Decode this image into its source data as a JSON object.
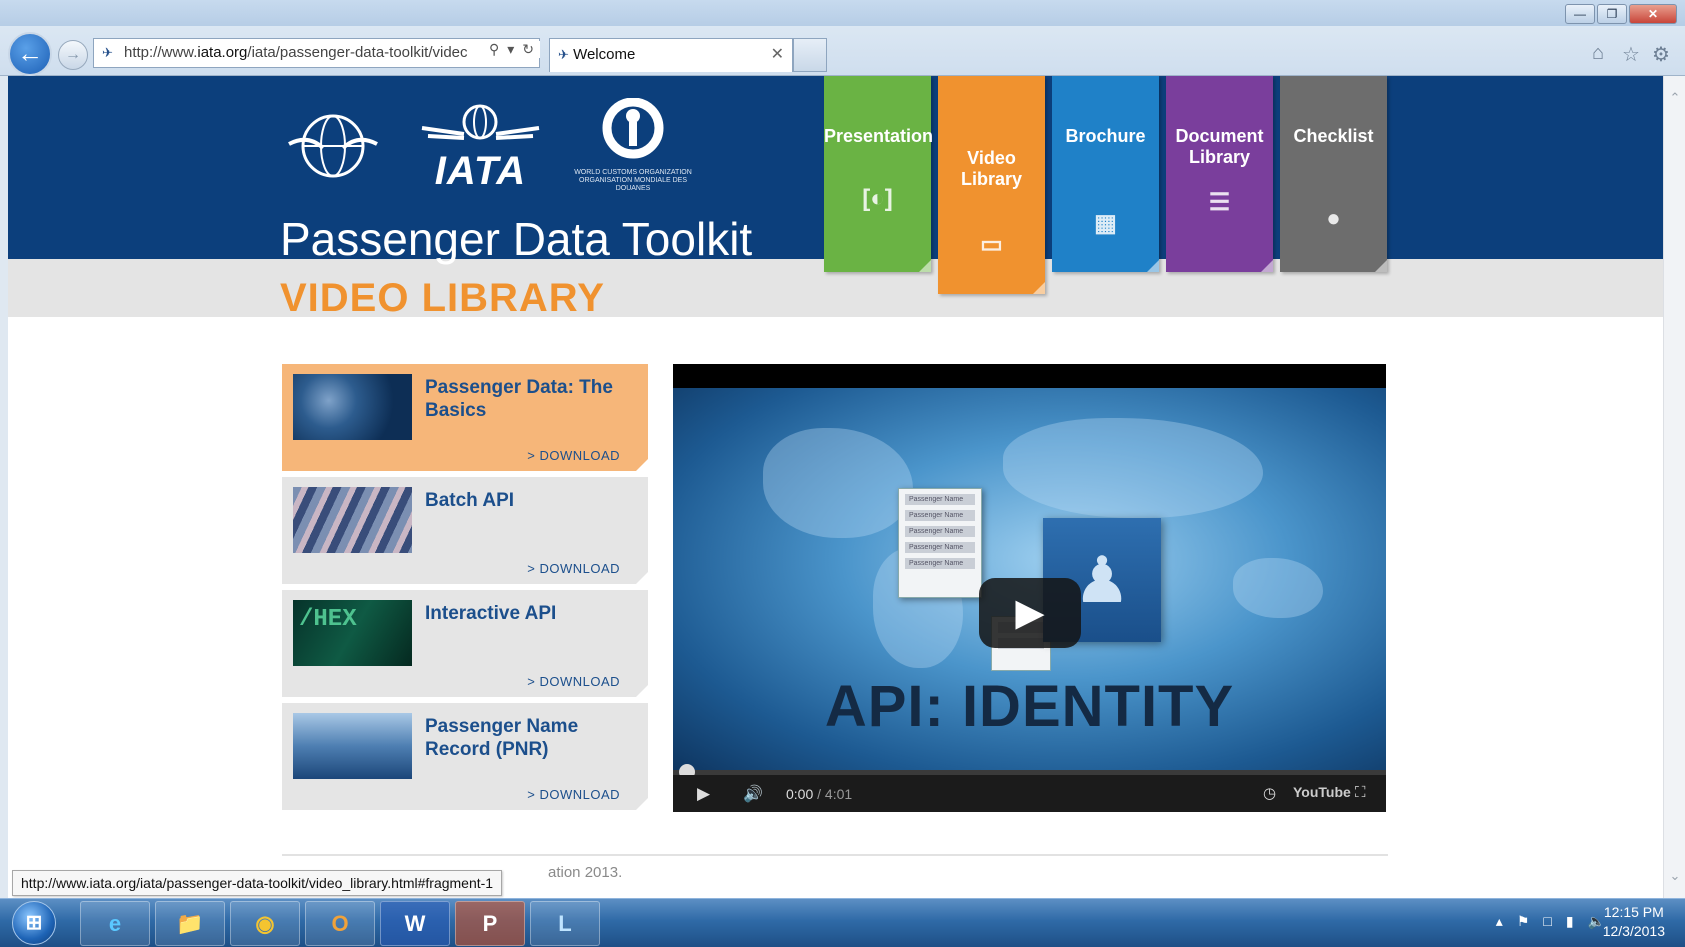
{
  "browser": {
    "address_prefix": "http://www.",
    "address_host": "iata.org",
    "address_rest": "/iata/passenger-data-toolkit/videc",
    "tab_title": "Welcome",
    "status_url": "http://www.iata.org/iata/passenger-data-toolkit/video_library.html#fragment-1"
  },
  "header": {
    "site_title": "Passenger Data Toolkit",
    "page_heading": "VIDEO LIBRARY",
    "logo_iata": "IATA",
    "logo_wco_line1": "WORLD CUSTOMS ORGANIZATION",
    "logo_wco_line2": "ORGANISATION MONDIALE DES DOUANES"
  },
  "nav": {
    "presentation": "Presentation",
    "video_line1": "Video",
    "video_line2": "Library",
    "brochure": "Brochure",
    "document_line1": "Document",
    "document_line2": "Library",
    "checklist": "Checklist"
  },
  "videos": [
    {
      "title": "Passenger Data: The Basics",
      "download": "> DOWNLOAD"
    },
    {
      "title": "Batch API",
      "download": "> DOWNLOAD"
    },
    {
      "title": "Interactive API",
      "download": "> DOWNLOAD",
      "thumb_text": "/HEX"
    },
    {
      "title": "Passenger Name Record (PNR)",
      "download": "> DOWNLOAD"
    }
  ],
  "player": {
    "video_title": "API: IDENTITY",
    "time": "0:00",
    "duration": "/ 4:01",
    "brand": "YouTube",
    "doc_row_label": "Passenger Name"
  },
  "footer": {
    "copyright_tail": "ation 2013."
  },
  "taskbar": {
    "time": "12:15 PM",
    "date": "12/3/2013"
  }
}
